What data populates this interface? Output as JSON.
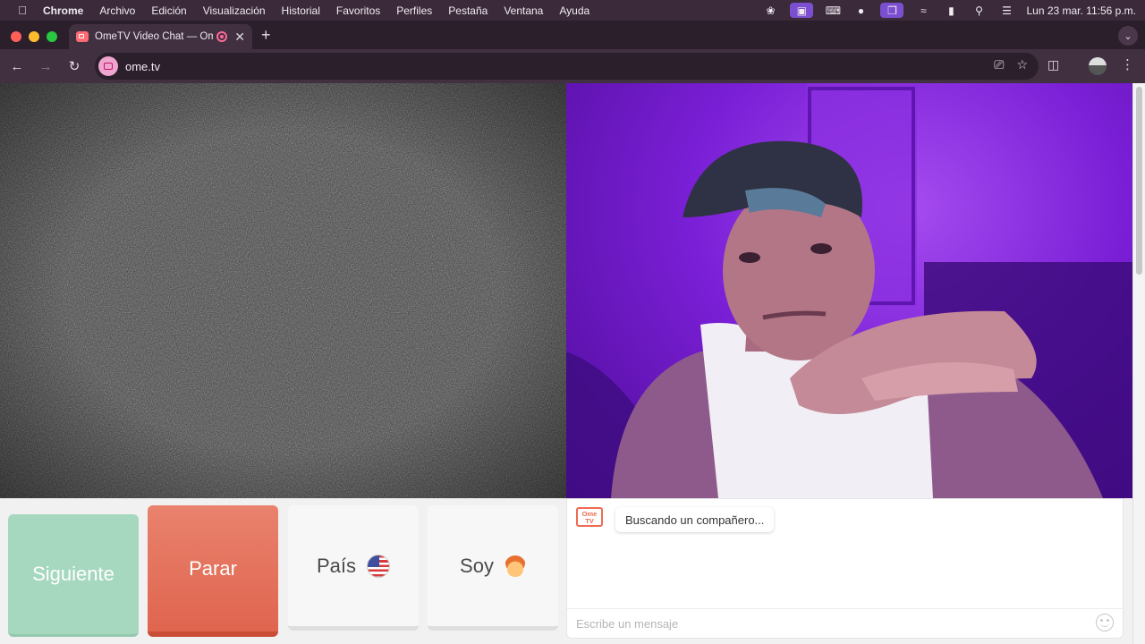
{
  "menubar": {
    "app_name": "Chrome",
    "menus": [
      "Archivo",
      "Edición",
      "Visualización",
      "Historial",
      "Favoritos",
      "Perfiles",
      "Pestaña",
      "Ventana",
      "Ayuda"
    ],
    "clock": "Lun 23 mar.  11:56 p.m."
  },
  "browser": {
    "tab_title": "OmeTV Video Chat — Omegle",
    "url": "ome.tv"
  },
  "controls": {
    "next_label": "Siguiente",
    "stop_label": "Parar",
    "country_label": "País",
    "gender_label": "Soy"
  },
  "chat": {
    "logo_text": "Ome TV",
    "status_message": "Buscando un compañero...",
    "input_placeholder": "Escribe un mensaje"
  },
  "colors": {
    "next_button": "#a6d7bf",
    "stop_button": "#e57360",
    "local_video_glow": "#7a1fd6"
  }
}
